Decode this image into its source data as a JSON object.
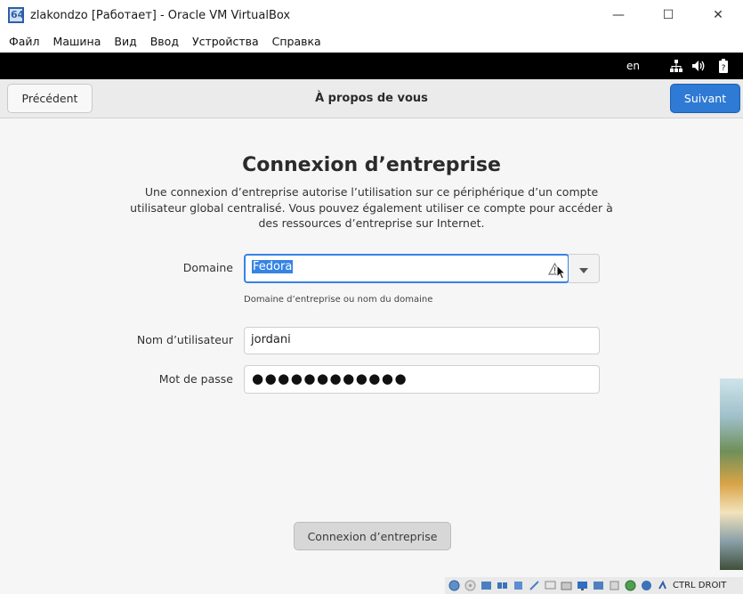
{
  "window": {
    "title": "zlakondzo [Работает] - Oracle VM VirtualBox",
    "minimize_glyph": "—",
    "maximize_glyph": "☐",
    "close_glyph": "✕"
  },
  "menu": {
    "items": [
      "Файл",
      "Машина",
      "Вид",
      "Ввод",
      "Устройства",
      "Справка"
    ]
  },
  "topbar": {
    "language": "en",
    "icons": [
      "network-icon",
      "volume-icon",
      "battery-icon"
    ]
  },
  "header": {
    "prev_label": "Précédent",
    "title": "À propos de vous",
    "next_label": "Suivant"
  },
  "form": {
    "heading": "Connexion d’entreprise",
    "description": "Une connexion d’entreprise autorise l’utilisation sur ce périphérique d’un compte utilisateur global centralisé. Vous pouvez également utiliser ce compte pour accéder à des ressources d’entreprise sur Internet.",
    "domain_label": "Domaine",
    "domain_value": "Fedora",
    "domain_hint": "Domaine d’entreprise ou nom du domaine",
    "username_label": "Nom d’utilisateur",
    "username_value": "jordani",
    "password_label": "Mot de passe",
    "password_mask": "●●●●●●●●●●●●",
    "connect_label": "Connexion d’entreprise"
  },
  "statusbar": {
    "host_key": "CTRL DROIT"
  },
  "colors": {
    "accent": "#3584e4",
    "suggested_button": "#2e7ad4",
    "topbar": "#000000"
  }
}
